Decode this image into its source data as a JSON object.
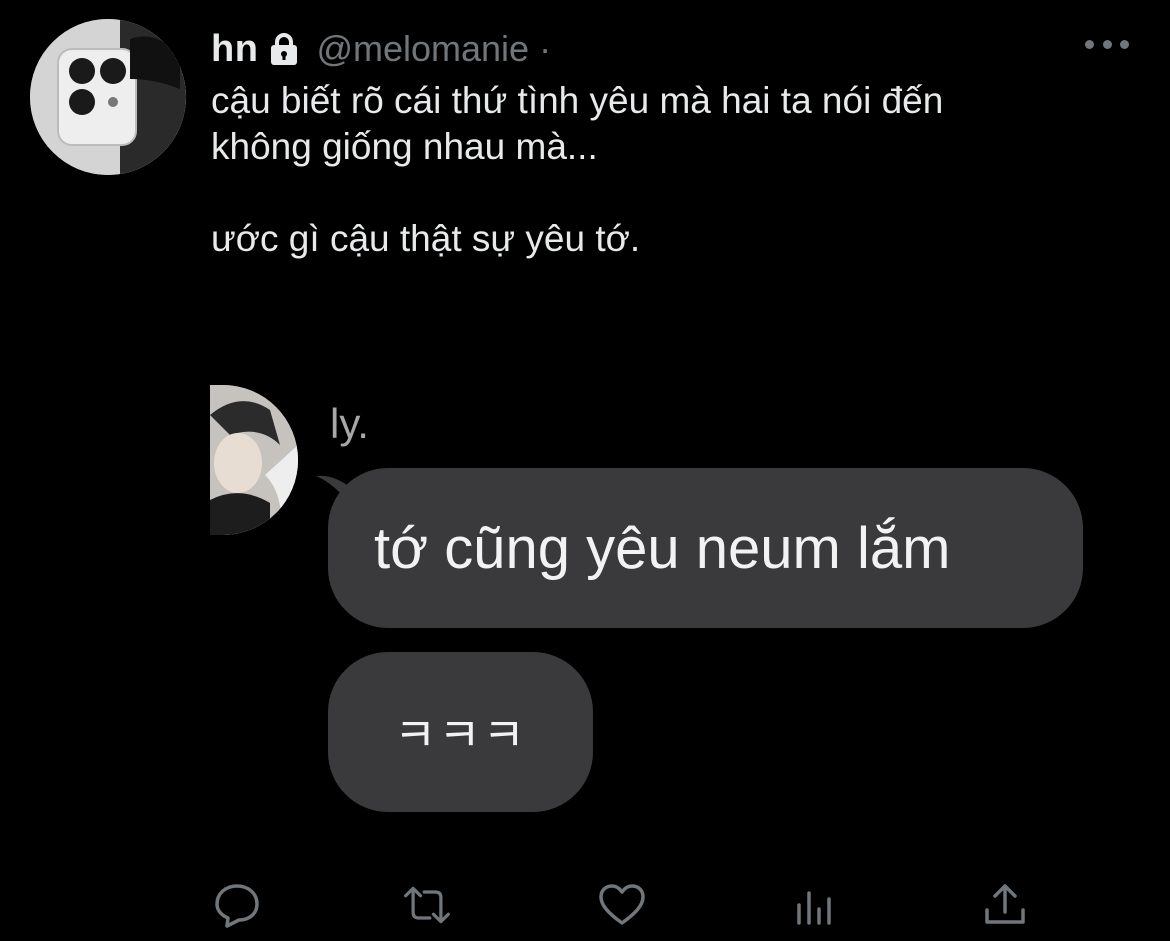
{
  "tweet": {
    "display_name": "hn",
    "handle": "@melomanie",
    "separator": "·",
    "text": "cậu biết rõ cái thứ tình yêu mà hai ta nói đến\nkhông giống nhau mà...\n\nước gì cậu thật sự yêu tớ.",
    "avatar_icon": "profile-photo",
    "locked_icon": "lock-icon"
  },
  "media": {
    "sender_name": "ly.",
    "messages": [
      {
        "text": "tớ cũng yêu neum lắm"
      },
      {
        "text": "ㅋㅋㅋ"
      }
    ]
  },
  "actions": {
    "icons": [
      "reply-icon",
      "retweet-icon",
      "like-icon",
      "analytics-icon",
      "share-icon"
    ]
  },
  "colors": {
    "background": "#000000",
    "text": "#e7e9ea",
    "secondary": "#71767b",
    "bubble": "#3a3a3c"
  }
}
